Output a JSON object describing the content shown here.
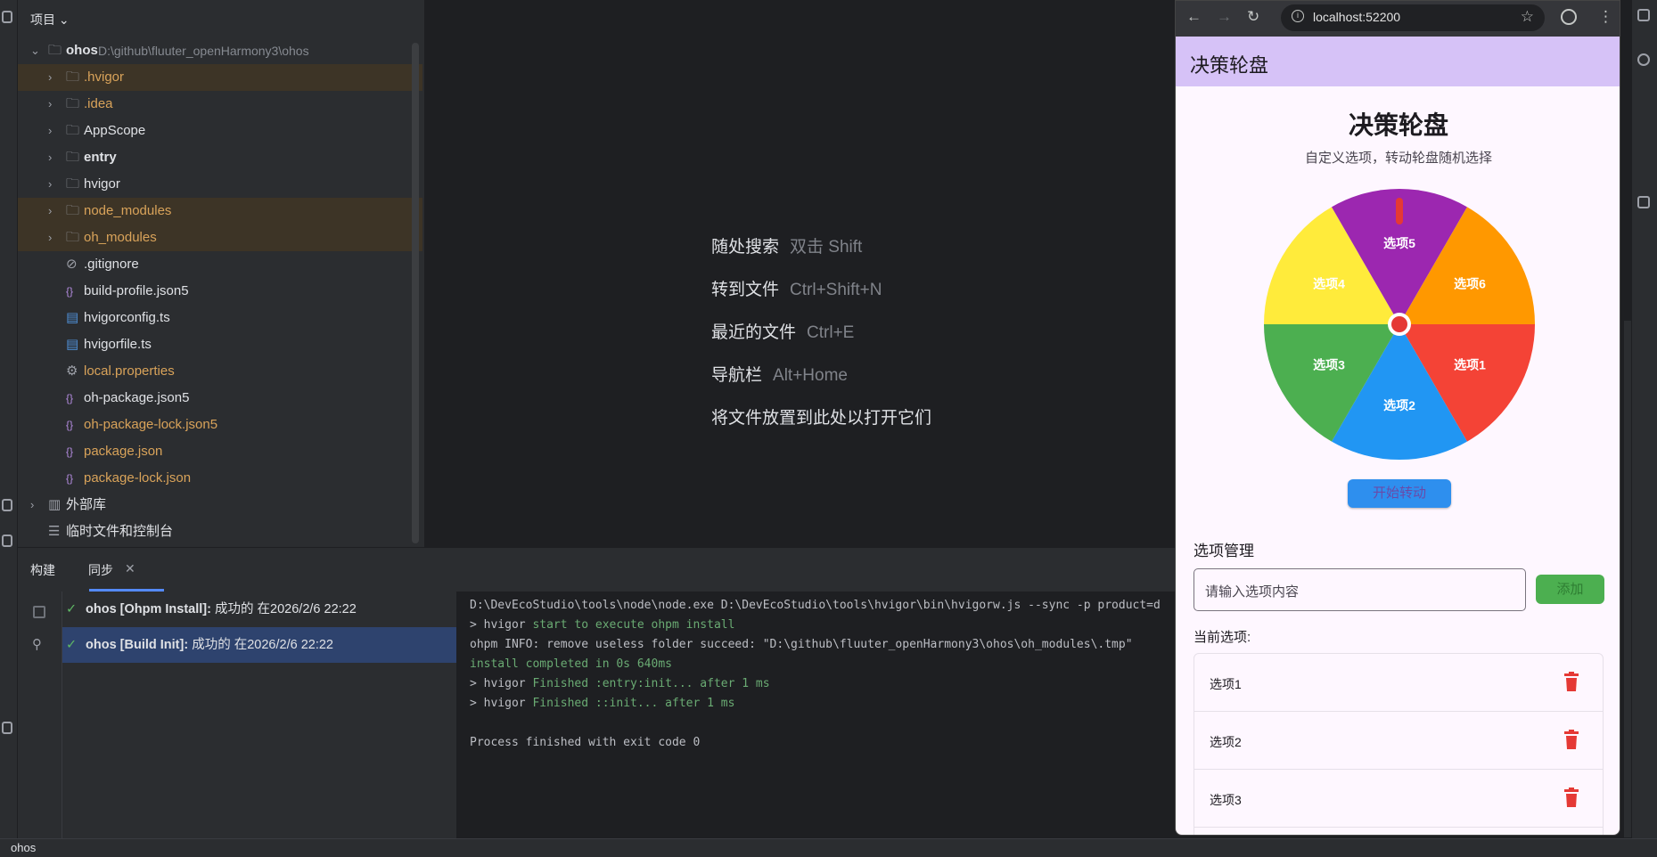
{
  "project": {
    "header": "项目",
    "tree": [
      {
        "label": "ohos",
        "path": "D:\\github\\fluuter_openHarmony3\\ohos",
        "type": "root",
        "color": "norm",
        "bold": true,
        "expanded": true,
        "icon": "module-folder-icon"
      },
      {
        "label": ".hvigor",
        "type": "folder",
        "color": "orange",
        "highlight": true,
        "icon": "folder-icon"
      },
      {
        "label": ".idea",
        "type": "folder",
        "color": "orange",
        "icon": "folder-icon"
      },
      {
        "label": "AppScope",
        "type": "folder",
        "color": "norm",
        "icon": "folder-icon"
      },
      {
        "label": "entry",
        "type": "folder",
        "color": "norm",
        "bold": true,
        "icon": "module-folder-icon"
      },
      {
        "label": "hvigor",
        "type": "folder",
        "color": "norm",
        "icon": "folder-icon"
      },
      {
        "label": "node_modules",
        "type": "folder",
        "color": "orange",
        "highlight": true,
        "icon": "folder-icon"
      },
      {
        "label": "oh_modules",
        "type": "folder",
        "color": "orange",
        "highlight": true,
        "icon": "folder-icon"
      },
      {
        "label": ".gitignore",
        "type": "file",
        "color": "norm",
        "icon": "gitignore-icon"
      },
      {
        "label": "build-profile.json5",
        "type": "file",
        "color": "norm",
        "icon": "json-icon"
      },
      {
        "label": "hvigorconfig.ts",
        "type": "file",
        "color": "norm",
        "icon": "typescript-icon"
      },
      {
        "label": "hvigorfile.ts",
        "type": "file",
        "color": "norm",
        "icon": "typescript-icon"
      },
      {
        "label": "local.properties",
        "type": "file",
        "color": "orange",
        "icon": "settings-icon"
      },
      {
        "label": "oh-package.json5",
        "type": "file",
        "color": "norm",
        "icon": "json-icon"
      },
      {
        "label": "oh-package-lock.json5",
        "type": "file",
        "color": "orange",
        "icon": "json-icon"
      },
      {
        "label": "package.json",
        "type": "file",
        "color": "orange",
        "icon": "json-icon"
      },
      {
        "label": "package-lock.json",
        "type": "file",
        "color": "orange",
        "icon": "json-icon"
      },
      {
        "label": "外部库",
        "type": "external",
        "color": "norm",
        "icon": "library-icon"
      },
      {
        "label": "临时文件和控制台",
        "type": "scratch",
        "color": "norm",
        "icon": "scratch-icon"
      }
    ]
  },
  "editor": {
    "hints": [
      {
        "label": "随处搜索",
        "shortcut": "双击 Shift"
      },
      {
        "label": "转到文件",
        "shortcut": "Ctrl+Shift+N"
      },
      {
        "label": "最近的文件",
        "shortcut": "Ctrl+E"
      },
      {
        "label": "导航栏",
        "shortcut": "Alt+Home"
      },
      {
        "label": "将文件放置到此处以打开它们",
        "shortcut": ""
      }
    ]
  },
  "build": {
    "tabs": [
      "构建",
      "同步"
    ],
    "items": [
      {
        "title": "ohos [Ohpm Install]:",
        "status": "成功的 在2026/2/6 22:22",
        "selected": false
      },
      {
        "title": "ohos [Build Init]:",
        "status": "成功的 在2026/2/6 22:22",
        "selected": true
      }
    ],
    "console": [
      {
        "prefix": "D:\\DevEcoStudio\\tools\\node\\node.exe D:\\DevEcoStudio\\tools\\hvigor\\bin\\hvigorw.js --sync -p product=d",
        "green": ""
      },
      {
        "prefix": "> hvigor ",
        "green": "start to execute ohpm install"
      },
      {
        "prefix": "ohpm INFO: remove useless folder succeed: \"D:\\github\\fluuter_openHarmony3\\ohos\\oh_modules\\.tmp\"",
        "green": ""
      },
      {
        "prefix": "",
        "green": "install completed in 0s 640ms"
      },
      {
        "prefix": "> hvigor ",
        "green": "Finished :entry:init... after 1 ms"
      },
      {
        "prefix": "> hvigor ",
        "green": "Finished ::init... after 1 ms"
      },
      {
        "prefix": "",
        "green": ""
      },
      {
        "prefix": "Process finished with exit code 0",
        "green": ""
      }
    ]
  },
  "status": {
    "project": "ohos"
  },
  "browser": {
    "url": "localhost:52200",
    "appbar_title": "决策轮盘",
    "page_title": "决策轮盘",
    "subtitle": "自定义选项，转动轮盘随机选择",
    "spin_button": "开始转动",
    "wheel": [
      {
        "label": "选项1",
        "color": "#f44336"
      },
      {
        "label": "选项2",
        "color": "#2196f3"
      },
      {
        "label": "选项3",
        "color": "#4caf50"
      },
      {
        "label": "选项4",
        "color": "#ffeb3b"
      },
      {
        "label": "选项5",
        "color": "#9c27b0"
      },
      {
        "label": "选项6",
        "color": "#ff9800"
      }
    ],
    "manage_title": "选项管理",
    "input_placeholder": "请输入选项内容",
    "add_button": "添加",
    "current_label": "当前选项:",
    "options": [
      "选项1",
      "选项2",
      "选项3"
    ],
    "pointer_color": "#e53935"
  }
}
